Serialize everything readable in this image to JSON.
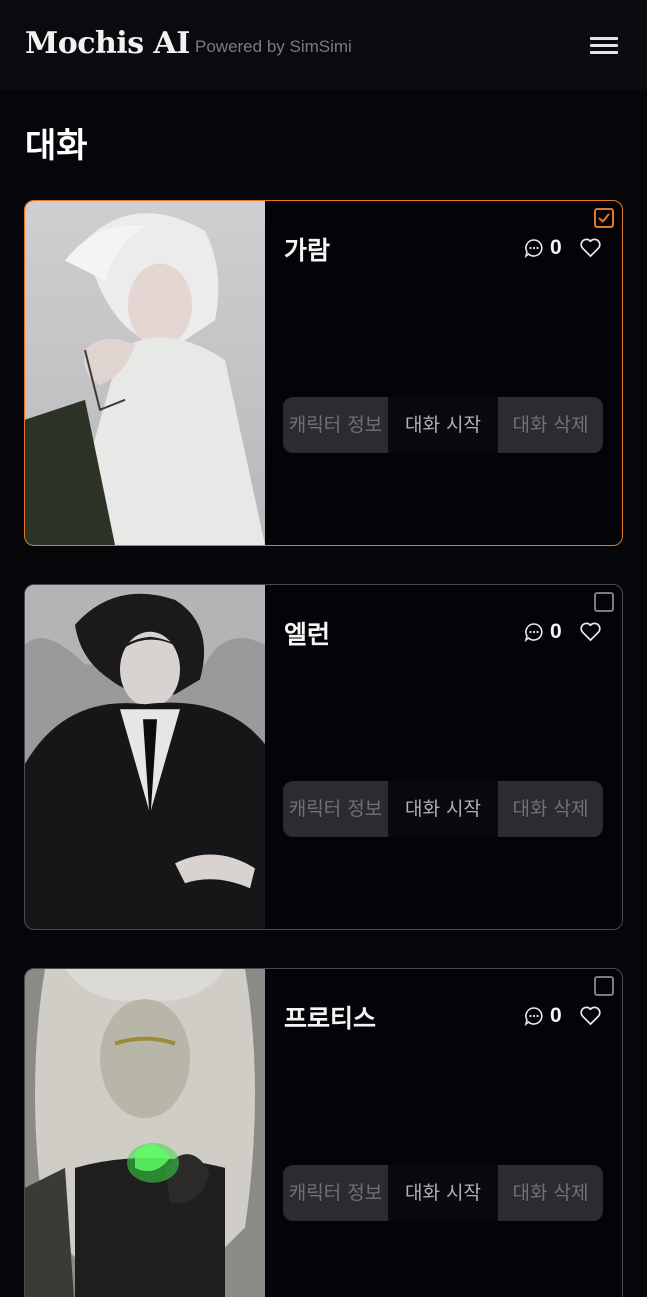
{
  "header": {
    "brand": "Mochis AI",
    "powered_by": "Powered by SimSimi",
    "menu_icon": "hamburger-menu-icon"
  },
  "page": {
    "title": "대화"
  },
  "colors": {
    "accent": "#e0782a",
    "background": "#05050a",
    "button_bg": "#2c2c30",
    "card_border": "#4a4a55"
  },
  "buttons": {
    "info_label": "캐릭터 정보",
    "start_label": "대화 시작",
    "delete_label": "대화 삭제"
  },
  "cards": [
    {
      "name": "가람",
      "chat_count": "0",
      "selected": true
    },
    {
      "name": "엘런",
      "chat_count": "0",
      "selected": false
    },
    {
      "name": "프로티스",
      "chat_count": "0",
      "selected": false
    }
  ]
}
